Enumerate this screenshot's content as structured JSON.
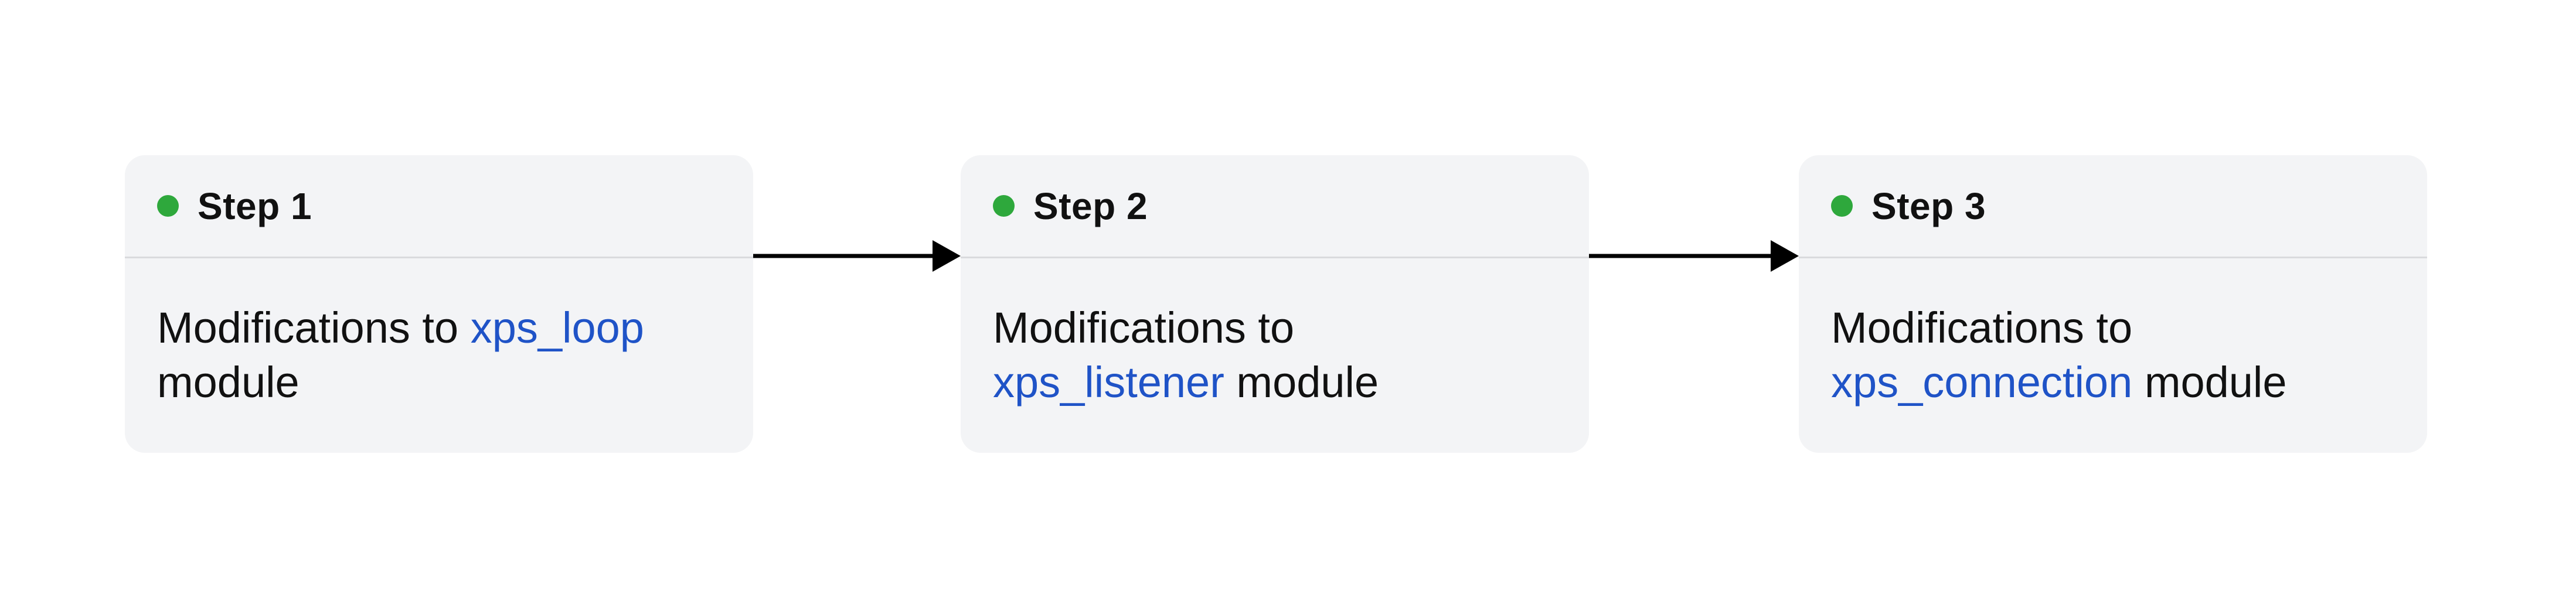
{
  "colors": {
    "card_background": "#f3f4f6",
    "divider": "#d9dadd",
    "status_dot": "#2ea83c",
    "module_link": "#1f53c7",
    "text": "#111111",
    "arrow": "#000000"
  },
  "steps": [
    {
      "title": "Step 1",
      "desc_prefix": "Modifications to",
      "module": "xps_loop",
      "desc_suffix": "module"
    },
    {
      "title": "Step 2",
      "desc_prefix": "Modifications to",
      "module": "xps_listener",
      "desc_suffix": "module"
    },
    {
      "title": "Step 3",
      "desc_prefix": "Modifications to",
      "module": "xps_connection",
      "desc_suffix": "module"
    }
  ]
}
